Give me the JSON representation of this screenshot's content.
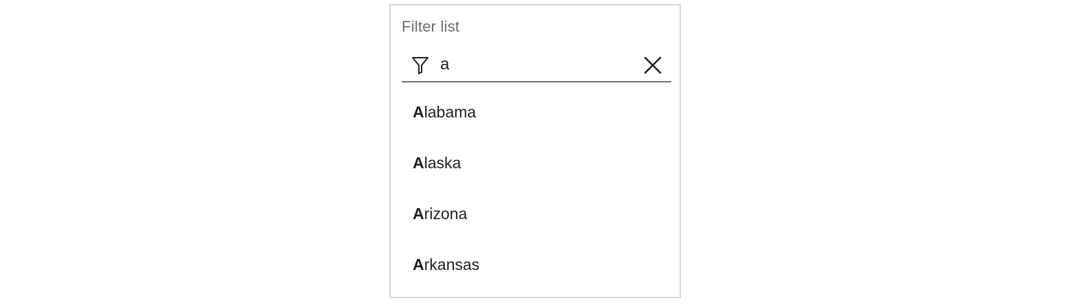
{
  "filter": {
    "label": "Filter list",
    "query": "a",
    "filter_icon": "filter-funnel-icon",
    "clear_icon": "close-x-icon"
  },
  "results": [
    {
      "match": "A",
      "rest": "labama"
    },
    {
      "match": "A",
      "rest": "laska"
    },
    {
      "match": "A",
      "rest": "rizona"
    },
    {
      "match": "A",
      "rest": "rkansas"
    }
  ],
  "colors": {
    "border": "#d6d6d6",
    "label": "#6b6b70",
    "underline": "#6e6e74",
    "text": "#1f1f1f"
  }
}
